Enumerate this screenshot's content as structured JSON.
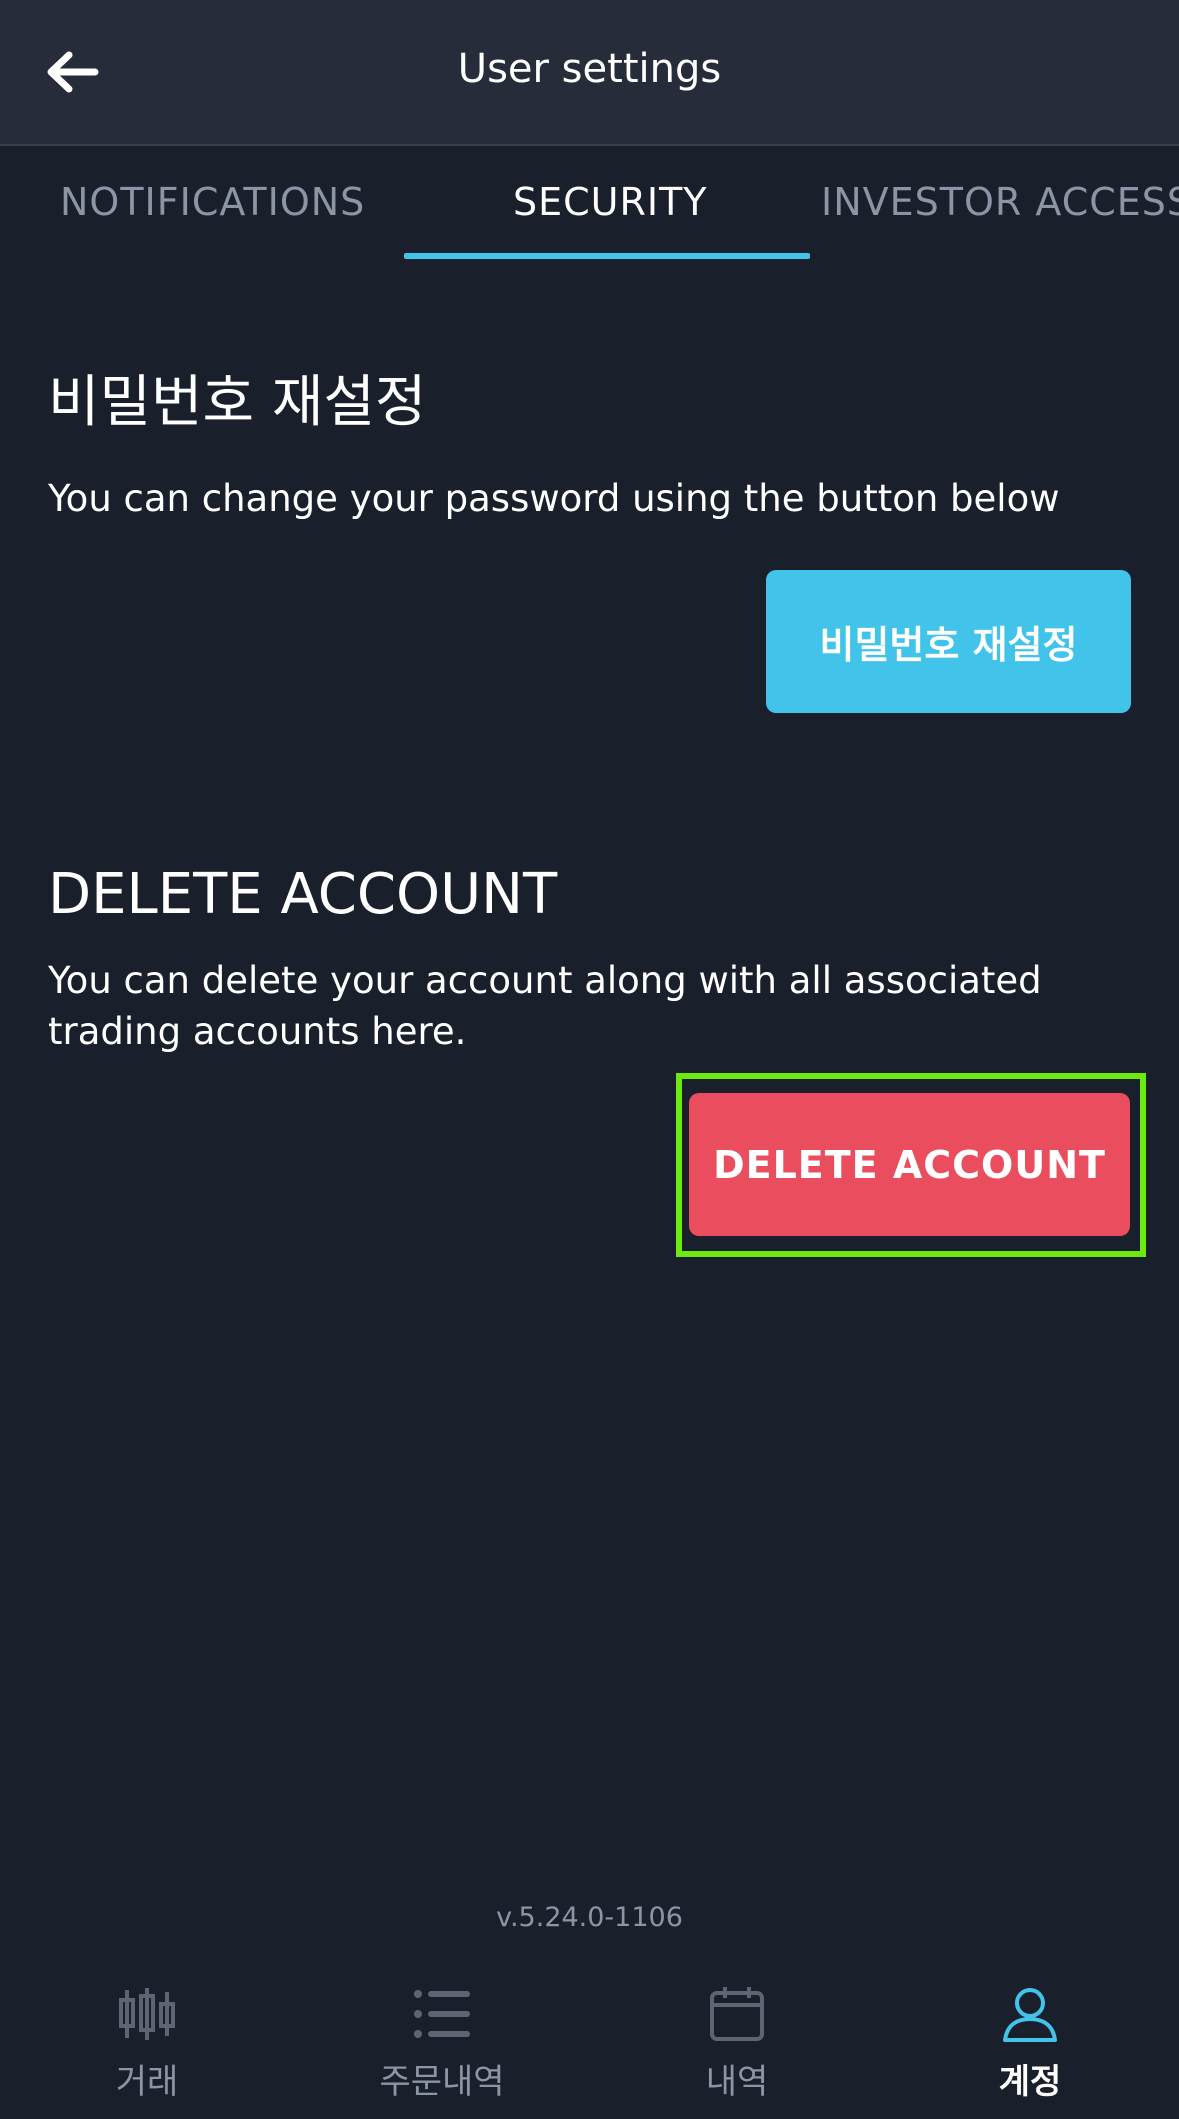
{
  "header": {
    "title": "User settings",
    "back_icon": "arrow-left-icon"
  },
  "tabs": [
    {
      "label": "NOTIFICATIONS",
      "active": false
    },
    {
      "label": "SECURITY",
      "active": true
    },
    {
      "label": "INVESTOR ACCESS",
      "active": false
    }
  ],
  "password_section": {
    "title": "비밀번호 재설정",
    "description": "You can change your password using the button below",
    "button_label": "비밀번호 재설정"
  },
  "delete_section": {
    "title": "DELETE ACCOUNT",
    "description": "You can delete your account along with all associated trading accounts here.",
    "button_label": "DELETE ACCOUNT"
  },
  "version": "v.5.24.0-1106",
  "bottom_nav": [
    {
      "label": "거래",
      "icon": "candlestick-chart-icon",
      "active": false
    },
    {
      "label": "주문내역",
      "icon": "list-icon",
      "active": false
    },
    {
      "label": "내역",
      "icon": "calendar-icon",
      "active": false
    },
    {
      "label": "계정",
      "icon": "user-icon",
      "active": true
    }
  ],
  "colors": {
    "background": "#1a1f2c",
    "header": "#272c3a",
    "accent": "#41c3ea",
    "danger": "#ea4e5e",
    "highlight": "#6ee80e",
    "muted_text": "#8c95a6"
  }
}
